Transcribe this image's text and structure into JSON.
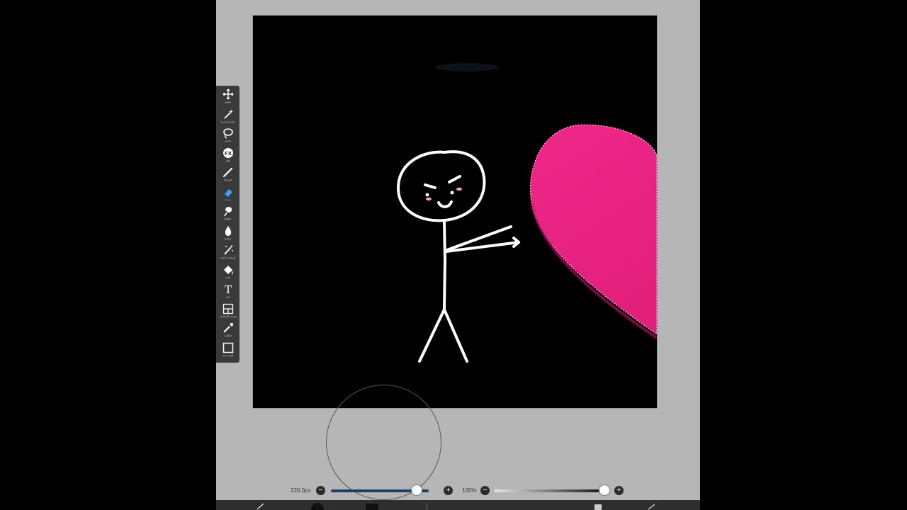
{
  "toolbar": {
    "tools": [
      {
        "name": "move",
        "icon": "move-icon",
        "label": "تحويل"
      },
      {
        "name": "magic-wand",
        "icon": "magic-wand-icon",
        "label": "عصا سحرية"
      },
      {
        "name": "lasso",
        "icon": "lasso-icon",
        "label": "تحديد"
      },
      {
        "name": "filter",
        "icon": "fx-icon",
        "label": "فلتر"
      },
      {
        "name": "brush",
        "icon": "brush-icon",
        "label": "فرشاة"
      },
      {
        "name": "eraser",
        "icon": "eraser-icon",
        "label": "ممحاة"
      },
      {
        "name": "smudge",
        "icon": "smudge-icon",
        "label": "تلطيخ"
      },
      {
        "name": "blur",
        "icon": "blur-icon",
        "label": "ضبابية"
      },
      {
        "name": "special-brush",
        "icon": "sparkle-icon",
        "label": "فرشاة خاصة"
      },
      {
        "name": "fill",
        "icon": "bucket-icon",
        "label": "ملء"
      },
      {
        "name": "text",
        "icon": "text-icon",
        "label": "نص"
      },
      {
        "name": "frame-divider",
        "icon": "frame-divider-icon",
        "label": "مقسم الإطارات"
      },
      {
        "name": "eyedropper",
        "icon": "eyedropper-icon",
        "label": "قطارة"
      },
      {
        "name": "canvas",
        "icon": "canvas-icon",
        "label": "لوح رسم"
      }
    ],
    "active": "eraser"
  },
  "brush_size": {
    "label": "220.0px",
    "value": 0.88
  },
  "opacity": {
    "label": "100%",
    "value": 1.0
  },
  "colors": {
    "app_bg": "#b6b6b6",
    "toolbar_bg": "#3a3a3a",
    "active_tool": "#3aa0ff",
    "heart": "#ec2a86",
    "size_track": "#1b3f66"
  }
}
